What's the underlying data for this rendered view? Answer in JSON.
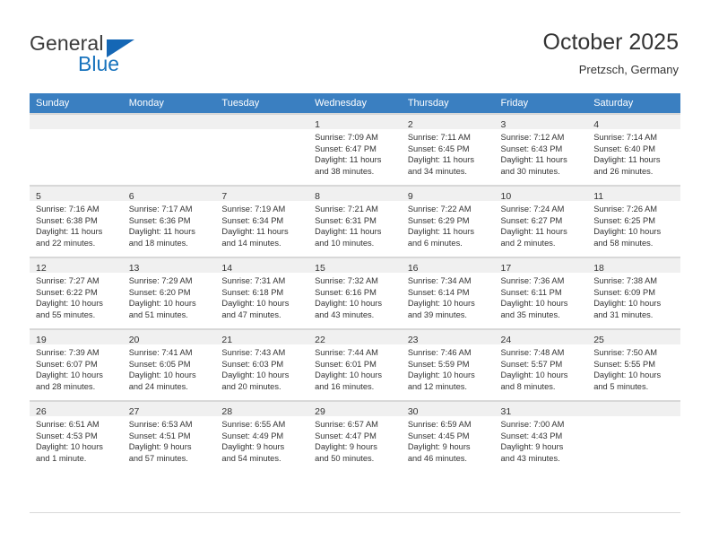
{
  "brand": {
    "name_part1": "General",
    "name_part2": "Blue",
    "logo_icon": "triangle-icon"
  },
  "header": {
    "title": "October 2025",
    "subtitle": "Pretzsch, Germany"
  },
  "colors": {
    "header_row": "#3a7fc1",
    "brand_blue": "#1873bd",
    "day_number_bg": "#f0f0f0",
    "grid_line": "#d9d9d9"
  },
  "weekdays": [
    "Sunday",
    "Monday",
    "Tuesday",
    "Wednesday",
    "Thursday",
    "Friday",
    "Saturday"
  ],
  "weeks": [
    [
      {
        "day": "",
        "sunrise": "",
        "sunset": "",
        "daylight_1": "",
        "daylight_2": "",
        "blank": true
      },
      {
        "day": "",
        "sunrise": "",
        "sunset": "",
        "daylight_1": "",
        "daylight_2": "",
        "blank": true
      },
      {
        "day": "",
        "sunrise": "",
        "sunset": "",
        "daylight_1": "",
        "daylight_2": "",
        "blank": true
      },
      {
        "day": "1",
        "sunrise": "Sunrise: 7:09 AM",
        "sunset": "Sunset: 6:47 PM",
        "daylight_1": "Daylight: 11 hours",
        "daylight_2": "and 38 minutes."
      },
      {
        "day": "2",
        "sunrise": "Sunrise: 7:11 AM",
        "sunset": "Sunset: 6:45 PM",
        "daylight_1": "Daylight: 11 hours",
        "daylight_2": "and 34 minutes."
      },
      {
        "day": "3",
        "sunrise": "Sunrise: 7:12 AM",
        "sunset": "Sunset: 6:43 PM",
        "daylight_1": "Daylight: 11 hours",
        "daylight_2": "and 30 minutes."
      },
      {
        "day": "4",
        "sunrise": "Sunrise: 7:14 AM",
        "sunset": "Sunset: 6:40 PM",
        "daylight_1": "Daylight: 11 hours",
        "daylight_2": "and 26 minutes."
      }
    ],
    [
      {
        "day": "5",
        "sunrise": "Sunrise: 7:16 AM",
        "sunset": "Sunset: 6:38 PM",
        "daylight_1": "Daylight: 11 hours",
        "daylight_2": "and 22 minutes."
      },
      {
        "day": "6",
        "sunrise": "Sunrise: 7:17 AM",
        "sunset": "Sunset: 6:36 PM",
        "daylight_1": "Daylight: 11 hours",
        "daylight_2": "and 18 minutes."
      },
      {
        "day": "7",
        "sunrise": "Sunrise: 7:19 AM",
        "sunset": "Sunset: 6:34 PM",
        "daylight_1": "Daylight: 11 hours",
        "daylight_2": "and 14 minutes."
      },
      {
        "day": "8",
        "sunrise": "Sunrise: 7:21 AM",
        "sunset": "Sunset: 6:31 PM",
        "daylight_1": "Daylight: 11 hours",
        "daylight_2": "and 10 minutes."
      },
      {
        "day": "9",
        "sunrise": "Sunrise: 7:22 AM",
        "sunset": "Sunset: 6:29 PM",
        "daylight_1": "Daylight: 11 hours",
        "daylight_2": "and 6 minutes."
      },
      {
        "day": "10",
        "sunrise": "Sunrise: 7:24 AM",
        "sunset": "Sunset: 6:27 PM",
        "daylight_1": "Daylight: 11 hours",
        "daylight_2": "and 2 minutes."
      },
      {
        "day": "11",
        "sunrise": "Sunrise: 7:26 AM",
        "sunset": "Sunset: 6:25 PM",
        "daylight_1": "Daylight: 10 hours",
        "daylight_2": "and 58 minutes."
      }
    ],
    [
      {
        "day": "12",
        "sunrise": "Sunrise: 7:27 AM",
        "sunset": "Sunset: 6:22 PM",
        "daylight_1": "Daylight: 10 hours",
        "daylight_2": "and 55 minutes."
      },
      {
        "day": "13",
        "sunrise": "Sunrise: 7:29 AM",
        "sunset": "Sunset: 6:20 PM",
        "daylight_1": "Daylight: 10 hours",
        "daylight_2": "and 51 minutes."
      },
      {
        "day": "14",
        "sunrise": "Sunrise: 7:31 AM",
        "sunset": "Sunset: 6:18 PM",
        "daylight_1": "Daylight: 10 hours",
        "daylight_2": "and 47 minutes."
      },
      {
        "day": "15",
        "sunrise": "Sunrise: 7:32 AM",
        "sunset": "Sunset: 6:16 PM",
        "daylight_1": "Daylight: 10 hours",
        "daylight_2": "and 43 minutes."
      },
      {
        "day": "16",
        "sunrise": "Sunrise: 7:34 AM",
        "sunset": "Sunset: 6:14 PM",
        "daylight_1": "Daylight: 10 hours",
        "daylight_2": "and 39 minutes."
      },
      {
        "day": "17",
        "sunrise": "Sunrise: 7:36 AM",
        "sunset": "Sunset: 6:11 PM",
        "daylight_1": "Daylight: 10 hours",
        "daylight_2": "and 35 minutes."
      },
      {
        "day": "18",
        "sunrise": "Sunrise: 7:38 AM",
        "sunset": "Sunset: 6:09 PM",
        "daylight_1": "Daylight: 10 hours",
        "daylight_2": "and 31 minutes."
      }
    ],
    [
      {
        "day": "19",
        "sunrise": "Sunrise: 7:39 AM",
        "sunset": "Sunset: 6:07 PM",
        "daylight_1": "Daylight: 10 hours",
        "daylight_2": "and 28 minutes."
      },
      {
        "day": "20",
        "sunrise": "Sunrise: 7:41 AM",
        "sunset": "Sunset: 6:05 PM",
        "daylight_1": "Daylight: 10 hours",
        "daylight_2": "and 24 minutes."
      },
      {
        "day": "21",
        "sunrise": "Sunrise: 7:43 AM",
        "sunset": "Sunset: 6:03 PM",
        "daylight_1": "Daylight: 10 hours",
        "daylight_2": "and 20 minutes."
      },
      {
        "day": "22",
        "sunrise": "Sunrise: 7:44 AM",
        "sunset": "Sunset: 6:01 PM",
        "daylight_1": "Daylight: 10 hours",
        "daylight_2": "and 16 minutes."
      },
      {
        "day": "23",
        "sunrise": "Sunrise: 7:46 AM",
        "sunset": "Sunset: 5:59 PM",
        "daylight_1": "Daylight: 10 hours",
        "daylight_2": "and 12 minutes."
      },
      {
        "day": "24",
        "sunrise": "Sunrise: 7:48 AM",
        "sunset": "Sunset: 5:57 PM",
        "daylight_1": "Daylight: 10 hours",
        "daylight_2": "and 8 minutes."
      },
      {
        "day": "25",
        "sunrise": "Sunrise: 7:50 AM",
        "sunset": "Sunset: 5:55 PM",
        "daylight_1": "Daylight: 10 hours",
        "daylight_2": "and 5 minutes."
      }
    ],
    [
      {
        "day": "26",
        "sunrise": "Sunrise: 6:51 AM",
        "sunset": "Sunset: 4:53 PM",
        "daylight_1": "Daylight: 10 hours",
        "daylight_2": "and 1 minute."
      },
      {
        "day": "27",
        "sunrise": "Sunrise: 6:53 AM",
        "sunset": "Sunset: 4:51 PM",
        "daylight_1": "Daylight: 9 hours",
        "daylight_2": "and 57 minutes."
      },
      {
        "day": "28",
        "sunrise": "Sunrise: 6:55 AM",
        "sunset": "Sunset: 4:49 PM",
        "daylight_1": "Daylight: 9 hours",
        "daylight_2": "and 54 minutes."
      },
      {
        "day": "29",
        "sunrise": "Sunrise: 6:57 AM",
        "sunset": "Sunset: 4:47 PM",
        "daylight_1": "Daylight: 9 hours",
        "daylight_2": "and 50 minutes."
      },
      {
        "day": "30",
        "sunrise": "Sunrise: 6:59 AM",
        "sunset": "Sunset: 4:45 PM",
        "daylight_1": "Daylight: 9 hours",
        "daylight_2": "and 46 minutes."
      },
      {
        "day": "31",
        "sunrise": "Sunrise: 7:00 AM",
        "sunset": "Sunset: 4:43 PM",
        "daylight_1": "Daylight: 9 hours",
        "daylight_2": "and 43 minutes."
      },
      {
        "day": "",
        "sunrise": "",
        "sunset": "",
        "daylight_1": "",
        "daylight_2": "",
        "blank": true
      }
    ]
  ]
}
